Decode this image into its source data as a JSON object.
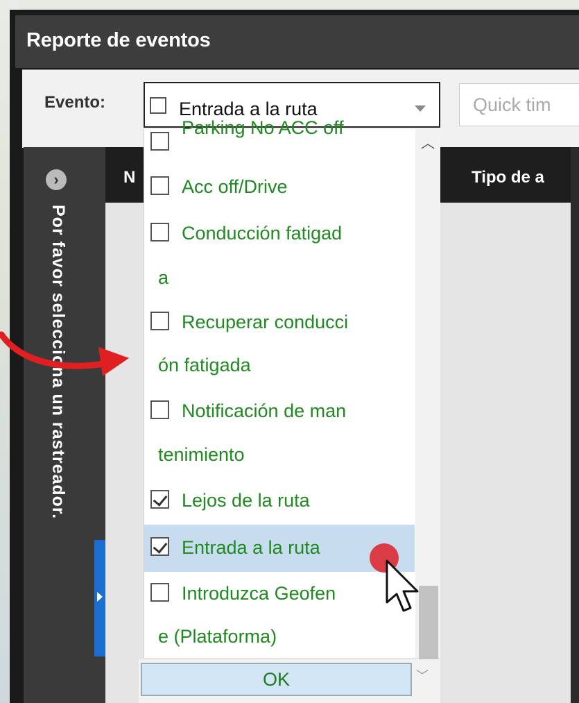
{
  "window": {
    "title": "Reporte de eventos"
  },
  "toolbar": {
    "event_label": "Evento:",
    "event_select_value": "Entrada a la ruta",
    "quick_time_placeholder": "Quick tim"
  },
  "side_panel": {
    "message": "Por favor selecciona un rastreador."
  },
  "table": {
    "headers": [
      "N",
      "Tipo de a"
    ]
  },
  "dropdown": {
    "options": [
      {
        "lines": [
          "Parking No ACC off"
        ],
        "checked": false
      },
      {
        "lines": [
          "Acc off/Drive"
        ],
        "checked": false
      },
      {
        "lines": [
          "Conducción fatigad",
          "a"
        ],
        "checked": false
      },
      {
        "lines": [
          "Recuperar conducci",
          "ón fatigada"
        ],
        "checked": false
      },
      {
        "lines": [
          "Notificación de man",
          "tenimiento"
        ],
        "checked": false
      },
      {
        "lines": [
          "Lejos de la ruta"
        ],
        "checked": true
      },
      {
        "lines": [
          "Entrada a la ruta"
        ],
        "checked": true,
        "highlighted": true
      },
      {
        "lines": [
          "Introduzca Geofen",
          "e (Plataforma)"
        ],
        "checked": false
      }
    ],
    "ok_label": "OK"
  },
  "colors": {
    "option_text": "#1f8a1f",
    "highlight": "#c7ddef",
    "titlebar": "#3d3d3d",
    "side_tab": "#1c6dd0",
    "annotation_red": "#e02020",
    "cursor_dot": "#dc3c45"
  },
  "icons": {
    "side_expand": "chevron-right-circle-icon",
    "select_arrow": "caret-down-icon",
    "scroll_up": "chevron-up-icon",
    "cursor": "mouse-pointer-icon",
    "annotation": "curved-arrow-icon"
  }
}
